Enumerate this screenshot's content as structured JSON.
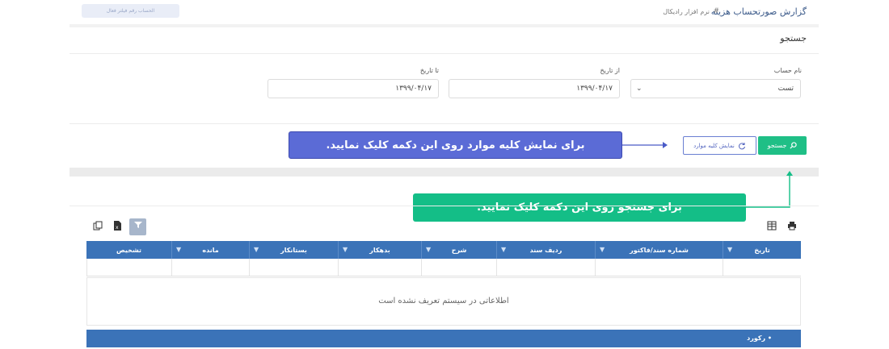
{
  "breadcrumb": {
    "title": "گزارش صورتحساب هزینه",
    "separator": "#",
    "subtitle": "نرم افزار رادیکال"
  },
  "top_pill": "الحساب رقم فیلتر فعال",
  "search": {
    "title": "جستجو"
  },
  "fields": {
    "account": {
      "label": "نام حساب",
      "value": "تست"
    },
    "from_date": {
      "label": "از تاریخ",
      "value": "۱۳۹۹/۰۴/۱۷"
    },
    "to_date": {
      "label": "تا تاریخ",
      "value": "۱۳۹۹/۰۴/۱۷"
    }
  },
  "buttons": {
    "search": "جستجو",
    "show_all": "نمایش کلیه موارد"
  },
  "callouts": {
    "show_all": "برای نمایش کلیه موارد روی این دکمه کلیک نمایید.",
    "search": "برای جستجو روی این دکمه کلیک نمایید."
  },
  "grid": {
    "columns": [
      "تاریخ",
      "شماره سند/فاکتور",
      "ردیف سند",
      "شرح",
      "بدهکار",
      "بستانکار",
      "مانده",
      "تشخیص"
    ],
    "empty_message": "اطلاعاتی در سیستم تعریف نشده است",
    "footer": "• رکورد"
  },
  "icons": {
    "print": "printer-icon",
    "columns": "columns-icon",
    "filter": "filter-icon",
    "excel": "excel-icon",
    "copy": "copy-icon",
    "search": "search-icon",
    "refresh": "refresh-icon"
  },
  "colors": {
    "primary_green": "#1fbf86",
    "grid_blue": "#3b73b8",
    "callout_blue": "#5b6bd6",
    "callout_green": "#14be87"
  }
}
